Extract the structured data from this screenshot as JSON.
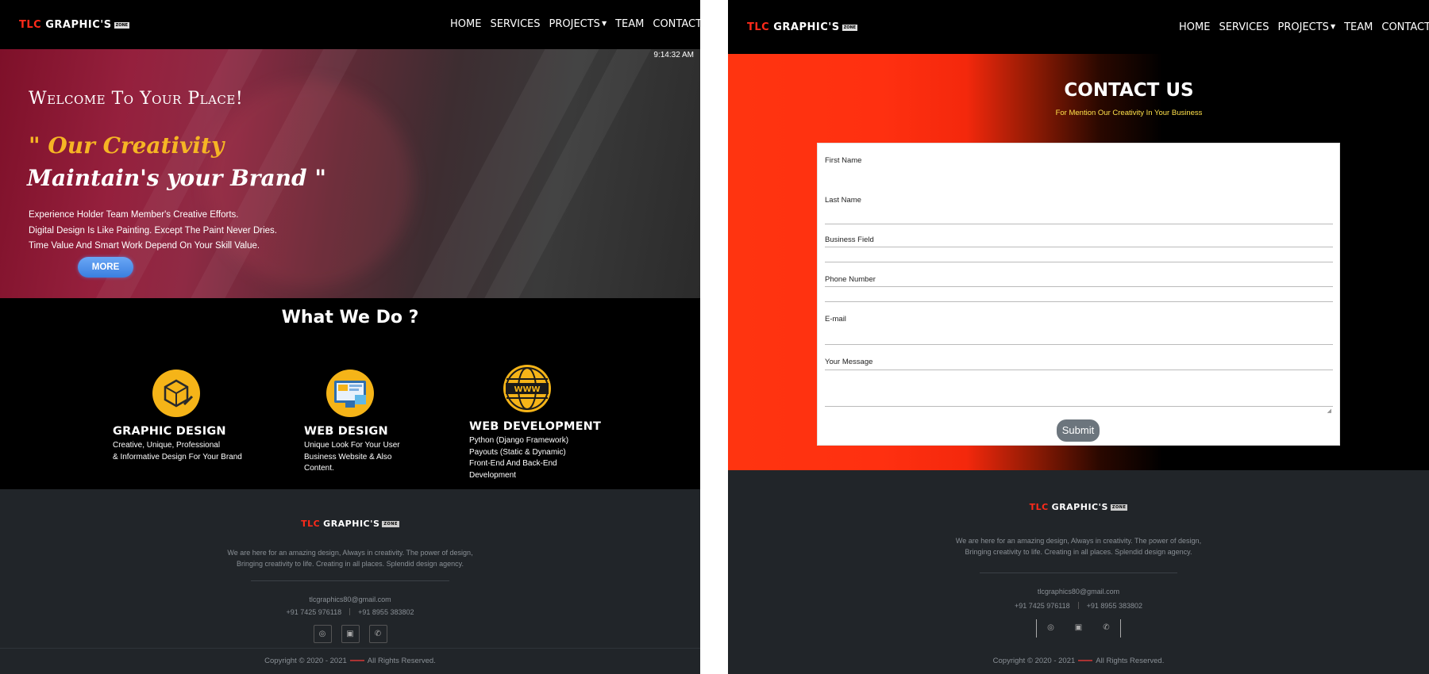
{
  "brand": {
    "tlc": "TLC",
    "graphics": "GRAPHIC'S",
    "zone": "ZONE"
  },
  "nav": {
    "home": "HOME",
    "services": "SERVICES",
    "projects": "PROJECTS",
    "team": "TEAM",
    "contact": "CONTACT"
  },
  "hero": {
    "clock": "9:14:32 AM",
    "welcome": "Welcome To Your Place!",
    "quote_line1": "\" Our Creativity",
    "quote_line2": "Maintain's your Brand \"",
    "line1": "Experience Holder Team Member's Creative Efforts.",
    "line2": "Digital Design Is Like Painting. Except The Paint Never Dries.",
    "line3": "Time Value And Smart Work Depend On Your Skill Value.",
    "more_label": "MORE"
  },
  "what_we_do": {
    "title": "What We Do ?",
    "services": [
      {
        "title": "GRAPHIC DESIGN",
        "line1": "Creative, Unique, Professional",
        "line2": "& Informative Design For Your Brand",
        "icon": "graphic-design-icon"
      },
      {
        "title": "WEB DESIGN",
        "line1": "Unique Look For Your User",
        "line2": "Business Website & Also",
        "line3": "Content.",
        "icon": "web-design-icon"
      },
      {
        "title": "WEB DEVELOPMENT",
        "line1": "Python (Django Framework)",
        "line2": "Payouts (Static & Dynamic)",
        "line3": "Front-End And Back-End",
        "line4": "Development",
        "icon": "www-globe-icon"
      }
    ]
  },
  "footer": {
    "desc_line1": "We are here for an amazing design, Always in creativity. The power of design,",
    "desc_line2": "Bringing creativity to life. Creating in all places. Splendid design agency.",
    "email": "tlcgraphics80@gmail.com",
    "phone1": "+91 7425 976118",
    "phone2": "+91 8955 383802",
    "copyright_pre": "Copyright © 2020 - 2021",
    "copyright_post": "All Rights Reserved.",
    "social_icons": [
      "instagram-icon",
      "facebook-icon",
      "whatsapp-icon"
    ]
  },
  "contact": {
    "title": "CONTACT US",
    "subtitle": "For Mention Our Creativity In Your Business",
    "fields": {
      "first_name": "First Name",
      "last_name": "Last Name",
      "business_field": "Business Field",
      "phone_number": "Phone Number",
      "email": "E-mail",
      "message": "Your Message"
    },
    "submit_label": "Submit"
  },
  "colors": {
    "accent_red": "#ff2a1a",
    "accent_yellow": "#f6b524",
    "footer_bg": "#212529",
    "submit_gray": "#6c757d"
  }
}
